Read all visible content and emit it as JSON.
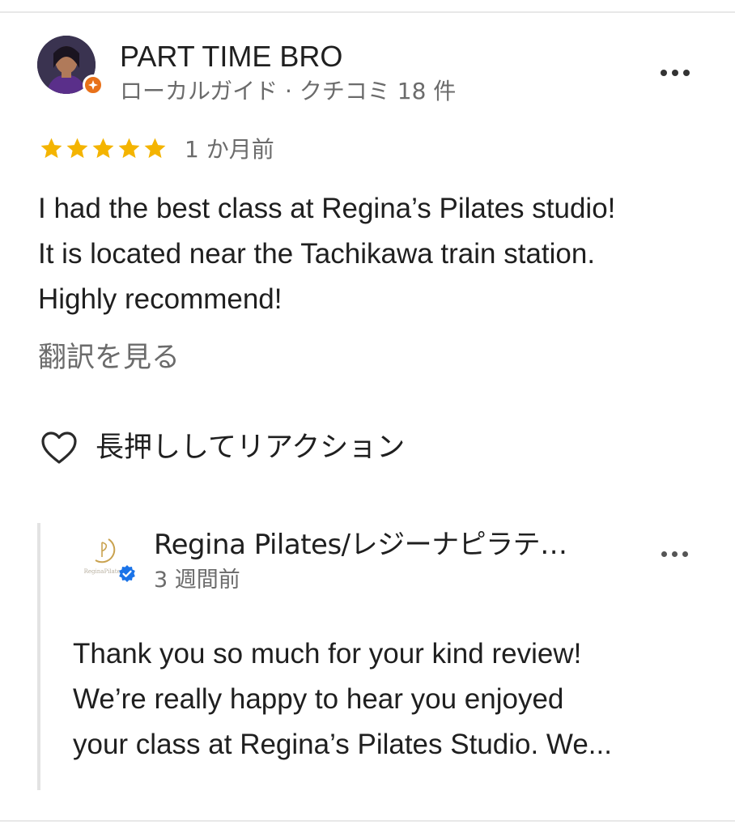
{
  "review": {
    "reviewer_name": "PART TIME BRO",
    "reviewer_meta": "ローカルガイド · クチコミ 18 件",
    "rating": 5,
    "rating_max": 5,
    "time_ago": "1 か月前",
    "text_lines": [
      "I had the best class at Regina’s Pilates studio!",
      "It is located near the Tachikawa train station.",
      "Highly recommend!"
    ],
    "translate_label": "翻訳を見る",
    "reaction_label": "長押ししてリアクション"
  },
  "owner_reply": {
    "owner_name": "Regina Pilates/レジーナピラテ…",
    "logo_text": "ReginaPilates",
    "time_ago": "3 週間前",
    "text_lines": [
      "Thank you so much for your kind review!",
      "We’re really happy to hear you enjoyed",
      "your class at Regina’s Pilates Studio. We..."
    ]
  },
  "colors": {
    "star": "#f4b400",
    "guide_badge": "#e8711a",
    "verified": "#1a73e8",
    "secondary_text": "#6b6b6b"
  },
  "icons": [
    "local-guide-badge-icon",
    "star-icon",
    "more-options-icon",
    "heart-outline-icon",
    "verified-badge-icon"
  ]
}
